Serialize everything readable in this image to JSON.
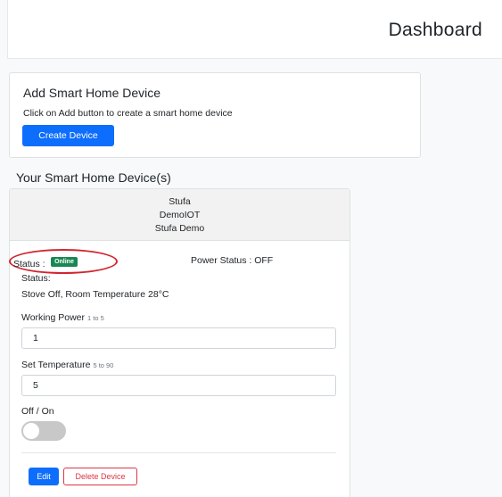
{
  "header": {
    "title": "Dashboard"
  },
  "add_card": {
    "heading": "Add Smart Home Device",
    "text": "Click on Add button to create a smart home device",
    "button_label": "Create Device"
  },
  "section_title": "Your Smart Home Device(s)",
  "device": {
    "name": "Stufa",
    "platform": "DemoIOT",
    "model": "Stufa Demo",
    "status_label": "Status :",
    "status_badge": "Online",
    "power_status": "Power Status : OFF",
    "status_label_2": "Status:",
    "status_text": "Stove Off, Room Temperature 28°C",
    "working_power": {
      "label": "Working Power",
      "hint": "1 to 5",
      "value": "1"
    },
    "set_temperature": {
      "label": "Set Temperature",
      "hint": "5 to 90",
      "value": "5"
    },
    "toggle": {
      "label": "Off / On",
      "checked": false
    },
    "edit_label": "Edit",
    "delete_label": "Delete Device"
  },
  "colors": {
    "primary": "#0d6efd",
    "success": "#198754",
    "danger": "#dc3545",
    "annotation": "#d0262f"
  }
}
